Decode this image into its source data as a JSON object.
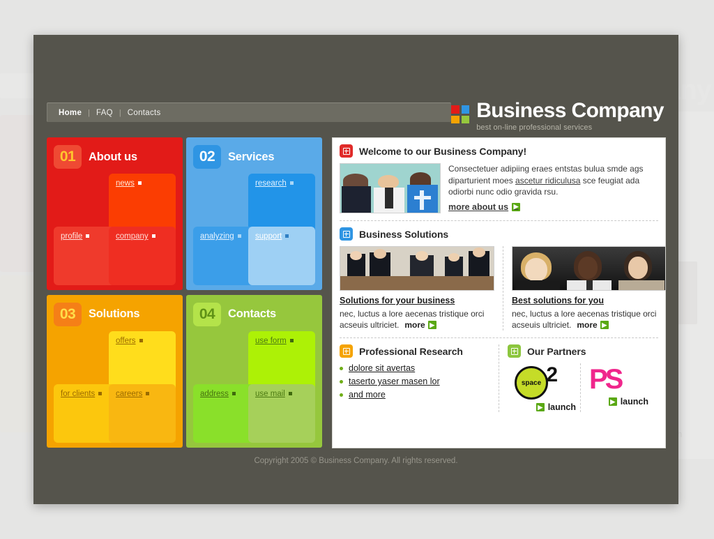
{
  "background": {
    "page_color": "#e5e5e4",
    "window_color": "#55544c"
  },
  "nav": {
    "items": [
      {
        "label": "Home",
        "active": true
      },
      {
        "label": "FAQ",
        "active": false
      },
      {
        "label": "Contacts",
        "active": false
      }
    ],
    "separator": "|"
  },
  "logo": {
    "title": "Business Company",
    "tagline": "best on-line professional services",
    "swatches": [
      "#e21b18",
      "#2f95e3",
      "#f5a300",
      "#96c73d"
    ]
  },
  "panels": [
    {
      "number": "01",
      "title": "About us",
      "accent": "#e21b18",
      "tiles": [
        {
          "label": "news",
          "position": "top-right"
        },
        {
          "label": "profile",
          "position": "bottom-left"
        },
        {
          "label": "company",
          "position": "bottom-right"
        }
      ]
    },
    {
      "number": "02",
      "title": "Services",
      "accent": "#5aaae8",
      "tiles": [
        {
          "label": "research",
          "position": "top-right"
        },
        {
          "label": "analyzing",
          "position": "bottom-left"
        },
        {
          "label": "support",
          "position": "bottom-right"
        }
      ]
    },
    {
      "number": "03",
      "title": "Solutions",
      "accent": "#f5a300",
      "tiles": [
        {
          "label": "offers",
          "position": "top-right"
        },
        {
          "label": "for clients",
          "position": "bottom-left"
        },
        {
          "label": "careers",
          "position": "bottom-right"
        }
      ]
    },
    {
      "number": "04",
      "title": "Contacts",
      "accent": "#96c73d",
      "tiles": [
        {
          "label": "use form",
          "position": "top-right"
        },
        {
          "label": "address",
          "position": "bottom-left"
        },
        {
          "label": "use mail",
          "position": "bottom-right"
        }
      ]
    }
  ],
  "content": {
    "welcome": {
      "icon_color": "#e02b29",
      "title": "Welcome to our Business Company!",
      "body_before": "Consectetuer adipiing eraes entstas bulua smde ags diparturient moes ",
      "body_link": "ascetur ridiculusa",
      "body_after": " sce feugiat ada odiorbi nunc odio gravida rsu.",
      "more_label": "more about us"
    },
    "solutions": {
      "icon_color": "#2f95e3",
      "title": "Business Solutions",
      "cards": [
        {
          "heading": "Solutions for your business",
          "text": "nec, luctus a lore aecenas tristique orci acseuis ultriciet.",
          "more_label": "more"
        },
        {
          "heading": "Best solutions for you",
          "text": "nec, luctus a lore aecenas tristique orci acseuis ultriciet.",
          "more_label": "more"
        }
      ]
    },
    "research": {
      "icon_color": "#f5a300",
      "title": "Professional Research",
      "links": [
        "dolore sit avertas",
        "taserto yaser masen lor",
        "and more"
      ]
    },
    "partners": {
      "icon_color": "#8cc63e",
      "title": "Our Partners",
      "items": [
        {
          "name": "space2",
          "mark_text": "space",
          "mark_sup": "2",
          "launch_label": "launch",
          "color": "#c5dc28"
        },
        {
          "name": "PS",
          "mark_text": "PS",
          "launch_label": "launch",
          "color": "#f0268c"
        }
      ]
    }
  },
  "footer": {
    "copyright": "Copyright 2005 © Business Company. All rights reserved."
  }
}
